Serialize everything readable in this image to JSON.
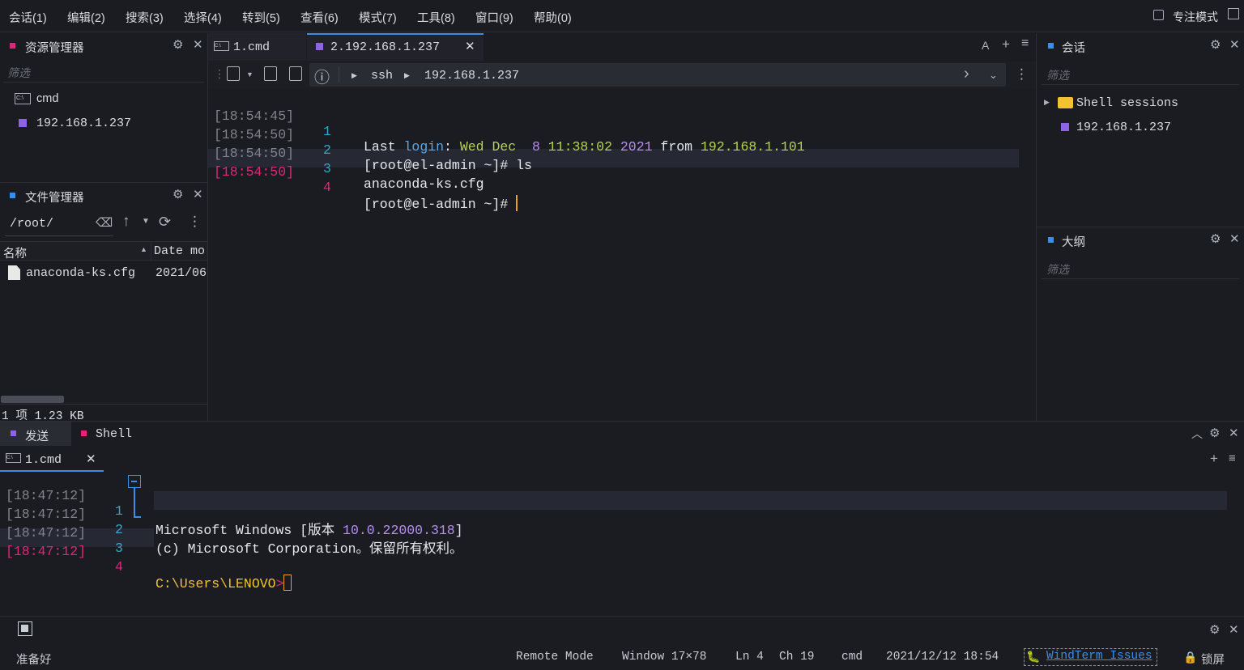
{
  "menu": [
    "会话(1)",
    "编辑(2)",
    "搜索(3)",
    "选择(4)",
    "转到(5)",
    "查看(6)",
    "模式(7)",
    "工具(8)",
    "窗口(9)",
    "帮助(0)"
  ],
  "focus_mode": "专注模式",
  "explorer": {
    "title": "资源管理器",
    "filter_placeholder": "筛选",
    "items": [
      {
        "label": "cmd",
        "icon": "cmd-icon"
      },
      {
        "label": "192.168.1.237",
        "icon": "session-square-icon"
      }
    ]
  },
  "file_manager": {
    "title": "文件管理器",
    "path": "/root/",
    "col_name": "名称",
    "col_date": "Date mo",
    "files": [
      {
        "name": "anaconda-ks.cfg",
        "date": "2021/06"
      }
    ],
    "summary": "1 项 1.23 KB"
  },
  "tabs": [
    {
      "label": "1.cmd",
      "active": false
    },
    {
      "label": "2.192.168.1.237",
      "active": true
    }
  ],
  "tab_tools": {
    "font": "A",
    "add": "+",
    "menu": "≡"
  },
  "toolbar": {
    "info": "ⓘ",
    "crumb1": "ssh",
    "crumb2": "192.168.1.237"
  },
  "terminal": {
    "lines": [
      {
        "ts": "[18:54:45]",
        "n": "1"
      },
      {
        "ts": "[18:54:50]",
        "n": "2"
      },
      {
        "ts": "[18:54:50]",
        "n": "3"
      },
      {
        "ts": "[18:54:50]",
        "n": "4"
      }
    ],
    "l1": {
      "a": "Last ",
      "b": "login",
      "c": ": ",
      "d": "Wed Dec  ",
      "e": "8",
      "f": " 11:38:02 ",
      "g": "2021",
      "h": " from ",
      "i": "192.168.1.101"
    },
    "l2": "[root@el-admin ~]# ls",
    "l3": "anaconda-ks.cfg",
    "l4": "[root@el-admin ~]# "
  },
  "sessions": {
    "title": "会话",
    "filter_placeholder": "筛选",
    "folder": "Shell sessions",
    "item": "192.168.1.237"
  },
  "outline": {
    "title": "大纲",
    "filter_placeholder": "筛选"
  },
  "bottom": {
    "tab_send": "发送",
    "tab_shell": "Shell",
    "subtab": "1.cmd",
    "lines": [
      {
        "ts": "[18:47:12]",
        "n": "1"
      },
      {
        "ts": "[18:47:12]",
        "n": "2"
      },
      {
        "ts": "[18:47:12]",
        "n": "3"
      },
      {
        "ts": "[18:47:12]",
        "n": "4"
      }
    ],
    "l1a": "Microsoft Windows [版本 ",
    "l1b": "10.0.22000.318",
    "l1c": "]",
    "l2": "(c) Microsoft Corporation。保留所有权利。",
    "l4a": "C:\\Users\\LENOVO",
    "l4b": ">"
  },
  "status": {
    "ready": "准备好",
    "mode": "Remote Mode",
    "window": "Window 17×78",
    "ln": "Ln 4",
    "ch": "Ch 19",
    "shell": "cmd",
    "datetime": "2021/12/12 18:54",
    "issues": "WindTerm Issues",
    "lock": "锁屏"
  },
  "colors": {
    "accent_blue": "#3a8ee6",
    "session_purple": "#8f63e8",
    "cmd_pink": "#e0267a",
    "ts_red": "#e0267a"
  }
}
